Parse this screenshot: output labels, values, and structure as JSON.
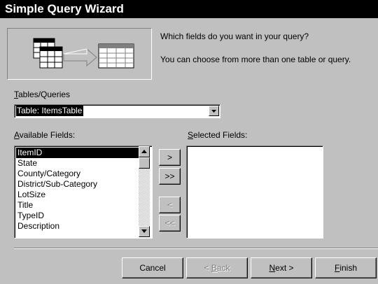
{
  "window": {
    "title": "Simple Query Wizard"
  },
  "intro": {
    "question": "Which fields do you want in your query?",
    "hint": "You can choose from more than one table or query."
  },
  "tables": {
    "label_mnemonic": "T",
    "label_rest": "ables/Queries",
    "selected": "Table: ItemsTable"
  },
  "available": {
    "label_mnemonic": "A",
    "label_rest": "vailable Fields:",
    "items": [
      "ItemID",
      "State",
      "County/Category",
      "District/Sub-Category",
      "LotSize",
      "Title",
      "TypeID",
      "Description"
    ],
    "selected_index": 0
  },
  "selected_fields": {
    "label_mnemonic": "S",
    "label_rest": "elected Fields:",
    "items": []
  },
  "move_buttons": {
    "add_one": ">",
    "add_all": ">>",
    "remove_one": "<",
    "remove_all": "<<"
  },
  "footer": {
    "cancel": "Cancel",
    "back_pre": "< ",
    "back_mnemonic": "B",
    "back_rest": "ack",
    "next_mnemonic": "N",
    "next_rest": "ext >",
    "finish_mnemonic": "F",
    "finish_rest": "inish"
  },
  "colors": {
    "title_bg": "#000000",
    "face": "#c0c0c0",
    "selection": "#000000"
  }
}
